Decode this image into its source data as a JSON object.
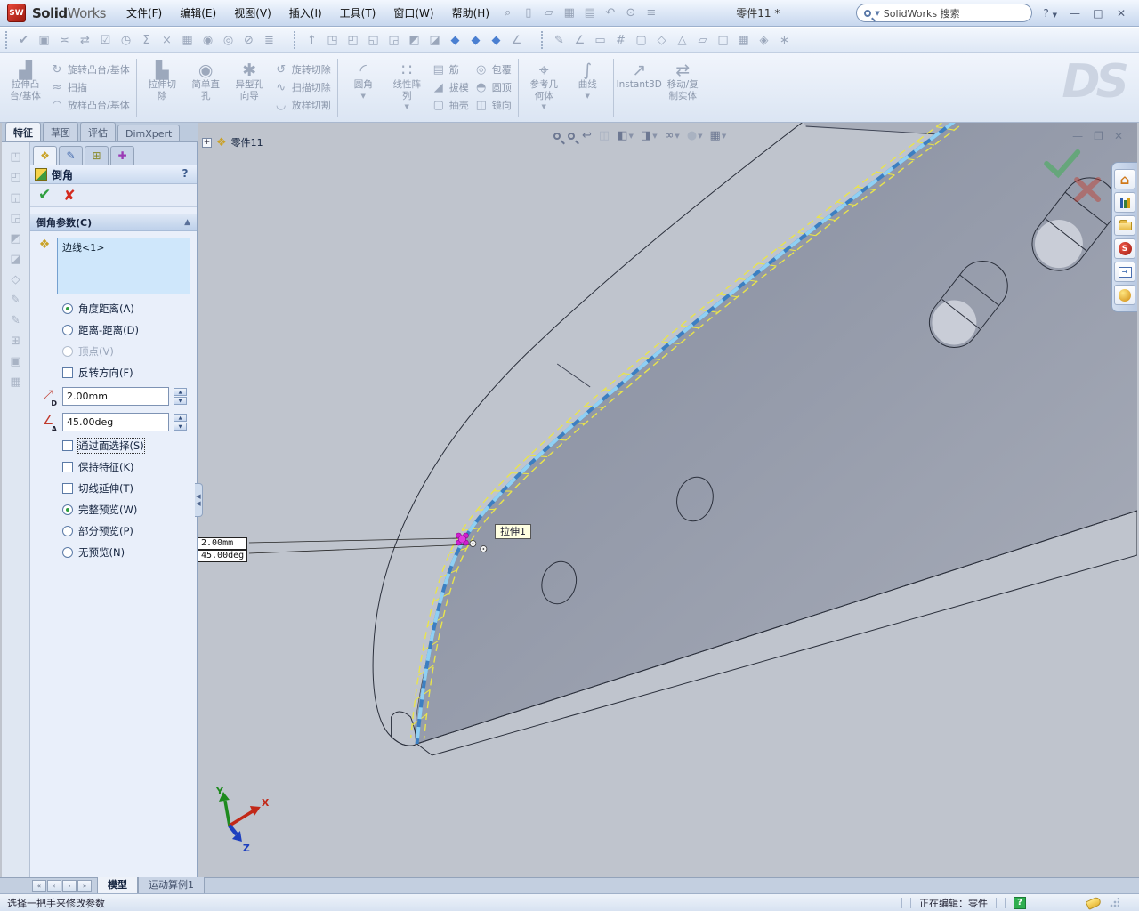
{
  "titlebar": {
    "logo_badge": "SW",
    "logo_text_1": "Solid",
    "logo_text_2": "Works",
    "title": "零件11 *",
    "search_value": "SolidWorks 搜索",
    "help_label": "?",
    "quick_icons": [
      "new-document-icon",
      "open-icon",
      "save-icon",
      "print-icon",
      "undo-icon",
      "attachment-icon",
      "options-icon"
    ]
  },
  "menubar": {
    "items": [
      "文件(F)",
      "编辑(E)",
      "视图(V)",
      "插入(I)",
      "工具(T)",
      "窗口(W)",
      "帮助(H)"
    ]
  },
  "toolbar": {
    "group1": [
      "spell-check-icon",
      "design-binder-icon",
      "compare-icon",
      "update-icon",
      "verify-icon",
      "schedule-icon",
      "equations-icon",
      "cut-icon",
      "table-icon",
      "preview-icon",
      "lighting-icon",
      "disable-icon",
      "layers-icon"
    ],
    "group2": [
      "origin-arrow-icon",
      "front-view-cube-icon",
      "back-view-cube-icon",
      "left-view-cube-icon",
      "right-view-cube-icon",
      "top-view-cube-icon",
      "bottom-view-cube-icon",
      "isometric-cube-icon",
      "dimetric-cube-icon",
      "trimetric-cube-icon",
      "measure-icon"
    ],
    "group3": [
      "sketch3d-icon",
      "angle-sketch-icon",
      "rectangle-sketch-icon",
      "grid-sketch-icon",
      "plane-sketch-icon",
      "diamond-sketch-icon",
      "triangle-sketch-icon",
      "parallelogram-sketch-icon",
      "box-sketch-icon",
      "table-sketch-icon",
      "gem-sketch-icon",
      "spark-sketch-icon"
    ]
  },
  "ribbon": {
    "watermark": "DS",
    "columns": [
      {
        "type": "big",
        "icon": "extrude-boss-icon",
        "lines": [
          "拉伸凸",
          "台/基体"
        ]
      },
      {
        "type": "stack",
        "items": [
          {
            "icon": "revolve-boss-icon",
            "label": "旋转凸台/基体"
          },
          {
            "icon": "sweep-boss-icon",
            "label": "扫描"
          },
          {
            "icon": "loft-boss-icon",
            "label": "放样凸台/基体"
          }
        ]
      },
      {
        "type": "sep"
      },
      {
        "type": "big",
        "icon": "extruded-cut-icon",
        "lines": [
          "拉伸切",
          "除"
        ]
      },
      {
        "type": "big",
        "icon": "simple-hole-icon",
        "lines": [
          "简单直",
          "孔"
        ]
      },
      {
        "type": "big",
        "icon": "hole-wizard-icon",
        "lines": [
          "异型孔",
          "向导"
        ]
      },
      {
        "type": "stack",
        "items": [
          {
            "icon": "revolved-cut-icon",
            "label": "旋转切除"
          },
          {
            "icon": "swept-cut-icon",
            "label": "扫描切除"
          },
          {
            "icon": "lofted-cut-icon",
            "label": "放样切割"
          }
        ]
      },
      {
        "type": "sep"
      },
      {
        "type": "big",
        "icon": "fillet-icon",
        "lines": [
          "圆角"
        ],
        "dropdown": true
      },
      {
        "type": "big",
        "icon": "linear-pattern-icon",
        "lines": [
          "线性阵",
          "列"
        ],
        "dropdown": true
      },
      {
        "type": "stack",
        "items": [
          {
            "icon": "rib-icon",
            "label": "筋"
          },
          {
            "icon": "draft-icon",
            "label": "拔模"
          },
          {
            "icon": "shell-icon",
            "label": "抽壳"
          }
        ]
      },
      {
        "type": "stack",
        "items": [
          {
            "icon": "wrap-icon",
            "label": "包覆"
          },
          {
            "icon": "dome-icon",
            "label": "圆顶"
          },
          {
            "icon": "mirror-icon",
            "label": "镜向"
          }
        ]
      },
      {
        "type": "sep"
      },
      {
        "type": "big",
        "icon": "reference-geometry-icon",
        "lines": [
          "参考几",
          "何体"
        ],
        "dropdown": true
      },
      {
        "type": "big",
        "icon": "curves-icon",
        "lines": [
          "曲线"
        ],
        "dropdown": true
      },
      {
        "type": "sep"
      },
      {
        "type": "big",
        "icon": "instant3d-icon",
        "lines": [
          "Instant3D"
        ]
      },
      {
        "type": "big",
        "icon": "move-copy-bodies-icon",
        "lines": [
          "移动/复",
          "制实体"
        ]
      }
    ]
  },
  "mode_tabs": {
    "items": [
      "特征",
      "草图",
      "评估",
      "DimXpert"
    ],
    "active_index": 0
  },
  "left_strip": {
    "icons": [
      "wireframe-view-icon",
      "hidden-lines-visible-icon",
      "hidden-lines-removed-icon",
      "shaded-edges-icon",
      "shaded-view-icon",
      "shadow-view-icon",
      "perspective-view-icon",
      "sketch-icon",
      "sketch-3d-icon",
      "reference-plane-icon",
      "pattern-strip-icon",
      "mirror-strip-icon"
    ]
  },
  "pm": {
    "tabs": [
      "properties-tab-icon",
      "notes-tab-icon",
      "configurations-tab-icon",
      "dimxpert-tab-icon"
    ],
    "title": "倒角",
    "help": "?",
    "params_header": "倒角参数(C)",
    "selection_value": "边线<1>",
    "type_radios": [
      {
        "label": "角度距离(A)",
        "selected": true,
        "disabled": false
      },
      {
        "label": "距离-距离(D)",
        "selected": false,
        "disabled": false
      },
      {
        "label": "顶点(V)",
        "selected": false,
        "disabled": true
      }
    ],
    "flip_label": "反转方向(F)",
    "distance_value": "2.00mm",
    "angle_value": "45.00deg",
    "distance_icon_letter": "D",
    "angle_icon_letter": "A",
    "option_checkboxes": [
      "通过面选择(S)",
      "保持特征(K)",
      "切线延伸(T)"
    ],
    "preview_radios": [
      {
        "label": "完整预览(W)",
        "selected": true
      },
      {
        "label": "部分预览(P)",
        "selected": false
      },
      {
        "label": "无预览(N)",
        "selected": false
      }
    ]
  },
  "viewport": {
    "flyout_label": "零件11",
    "tooltip": "拉伸1",
    "callout_line1": "2.00mm",
    "callout_line2": "45.00deg",
    "triad": {
      "x": "X",
      "y": "Y",
      "z": "Z"
    },
    "headsup": [
      {
        "name": "zoom-fit-icon"
      },
      {
        "name": "zoom-area-icon"
      },
      {
        "name": "previous-view-icon"
      },
      {
        "name": "section-view-icon",
        "disabled": true
      },
      {
        "name": "view-orientation-icon",
        "dropdown": true
      },
      {
        "name": "display-style-icon",
        "dropdown": true
      },
      {
        "name": "hide-show-items-icon",
        "dropdown": true
      },
      {
        "name": "appearances-icon",
        "dropdown": true,
        "disabled": true
      },
      {
        "name": "scene-icon",
        "dropdown": true
      }
    ]
  },
  "taskpane": {
    "icons": [
      "resources-home-icon",
      "design-library-icon",
      "file-explorer-icon",
      "solidworks-forum-icon",
      "view-palette-icon",
      "appearances-scenes-icon"
    ]
  },
  "bottom": {
    "nav_icons": [
      "first-tab-icon",
      "prev-tab-icon",
      "next-tab-icon",
      "last-tab-icon"
    ],
    "tabs": [
      "模型",
      "运动算例1"
    ],
    "active_index": 0
  },
  "statusbar": {
    "message": "选择一把手来修改参数",
    "editing": "正在编辑：零件"
  },
  "colors": {
    "highlight_edge": "#4f9bd8",
    "preview_yellow": "#e9e44c",
    "handle_magenta": "#cf1fcf",
    "confirm_green": "#3fae53",
    "cancel_red": "#c0392b"
  }
}
